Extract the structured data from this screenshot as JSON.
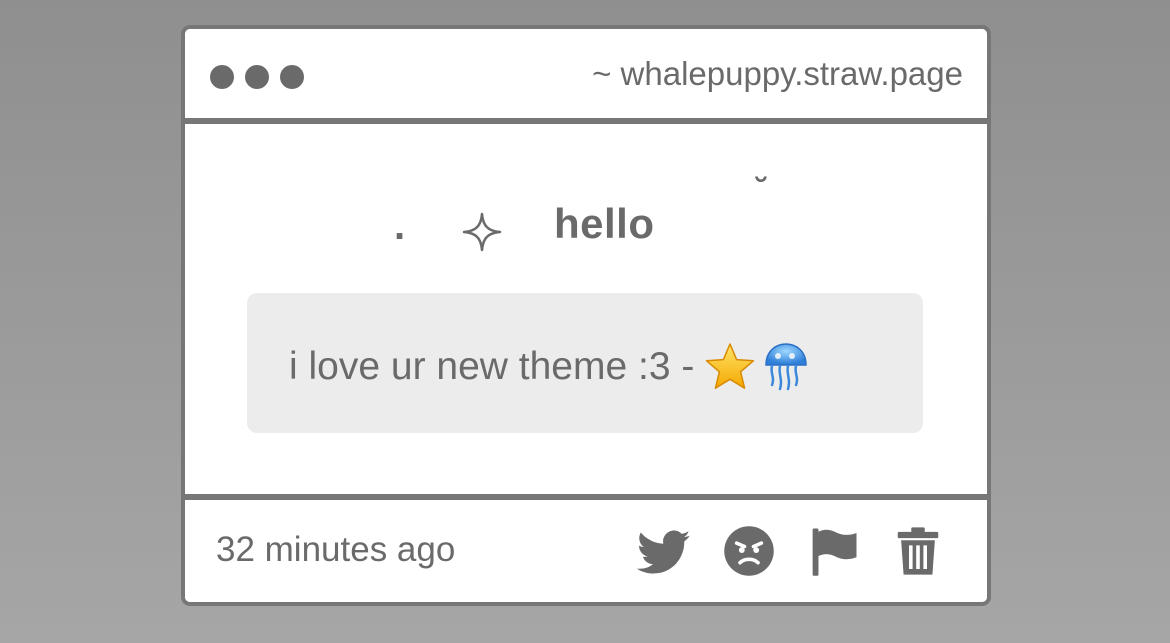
{
  "window": {
    "url": "~ whalepuppy.straw.page",
    "titlebar_dots": 3
  },
  "post": {
    "title_prefix": ".",
    "title_sparkle": "sparkle-icon",
    "title": "hello",
    "title_suffix": "˘",
    "message": "i love ur new theme :3 -",
    "message_emojis": [
      "star-emoji",
      "jellyfish-emoji"
    ]
  },
  "footer": {
    "timestamp": "32 minutes ago",
    "actions": [
      "twitter-share",
      "angry-react",
      "report-flag",
      "delete-trash"
    ]
  },
  "colors": {
    "background_top": "#8f8f8f",
    "background_bottom": "#a6a6a6",
    "window_border": "#777777",
    "text": "#6a6a6a",
    "message_bg": "#ececec"
  }
}
